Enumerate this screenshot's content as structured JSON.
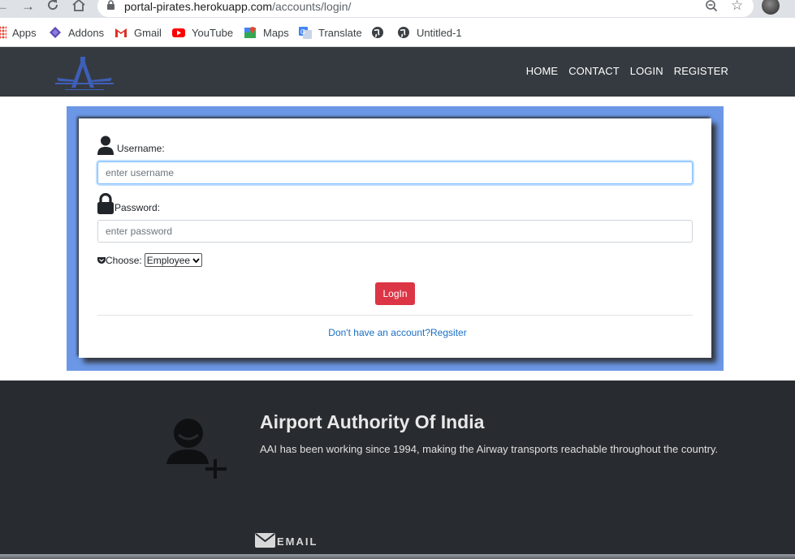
{
  "browser": {
    "url_host": "portal-pirates.herokuapp.com",
    "url_path": "/accounts/login/",
    "bookmarks": [
      {
        "label": "Apps",
        "icon": "apps-grid-icon"
      },
      {
        "label": "Addons",
        "icon": "addons-icon"
      },
      {
        "label": "Gmail",
        "icon": "gmail-icon"
      },
      {
        "label": "YouTube",
        "icon": "youtube-icon"
      },
      {
        "label": "Maps",
        "icon": "maps-icon"
      },
      {
        "label": "Translate",
        "icon": "translate-icon"
      },
      {
        "label": "",
        "icon": "globe-icon"
      },
      {
        "label": "Untitled-1",
        "icon": "globe-icon"
      }
    ]
  },
  "navbar": {
    "links": [
      "HOME",
      "CONTACT",
      "LOGIN",
      "REGISTER"
    ]
  },
  "form": {
    "username_label": "Username:",
    "username_placeholder": "enter username",
    "password_label": "Password:",
    "password_placeholder": "enter password",
    "choose_label": "Choose:",
    "choose_selected": "Employee",
    "login_button": "LogIn",
    "register_prompt": "Don't have an account?Regsiter"
  },
  "footer": {
    "title": "Airport Authority Of India",
    "description": "AAI has been working since 1994, making the Airway transports reachable throughout the country.",
    "email_label": "EMAIL"
  },
  "colors": {
    "navbar_bg": "#353a40",
    "frame_blue": "#6b97e6",
    "login_red": "#dc3545",
    "footer_bg": "#282b2f",
    "link_blue": "#1a6fc2"
  }
}
